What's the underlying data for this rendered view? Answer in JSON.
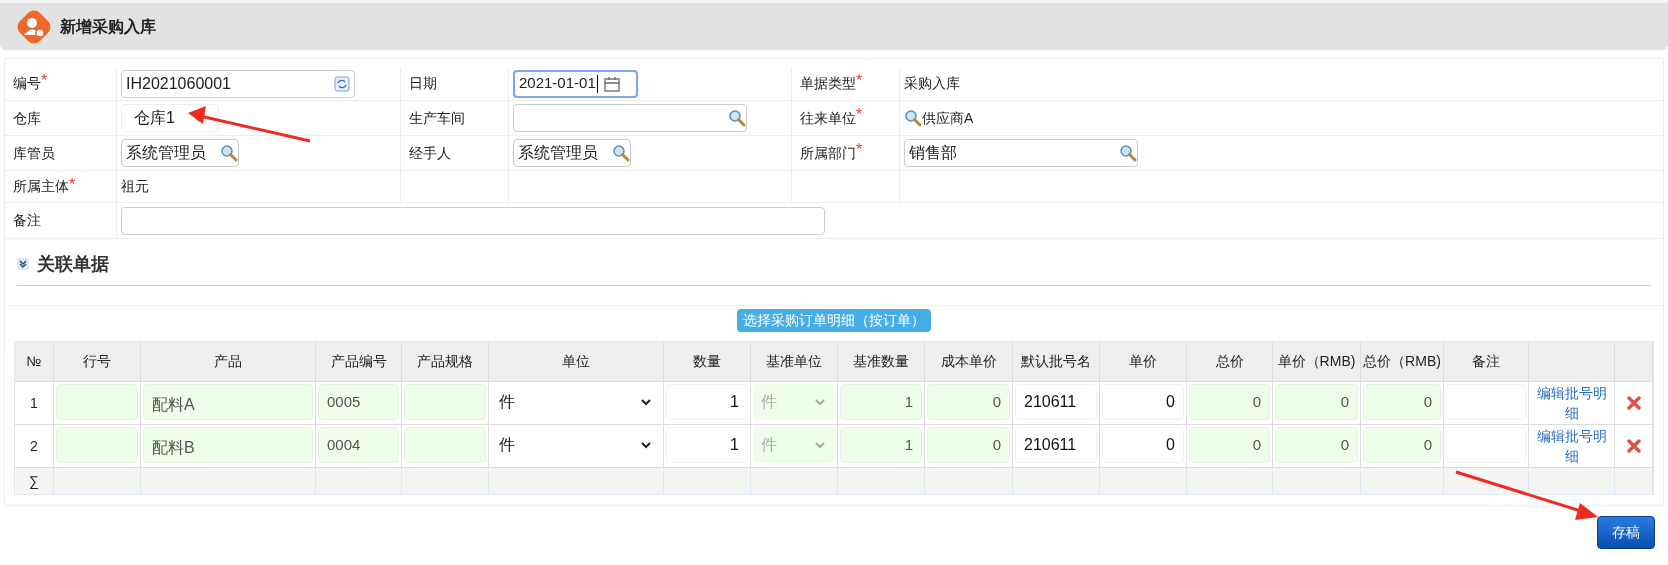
{
  "header": {
    "title": "新增采购入库"
  },
  "form": {
    "rows": [
      {
        "fields": [
          {
            "label": "编号",
            "required_mark": "*",
            "kind": "code",
            "value": "IH2021060001"
          },
          {
            "label": "日期",
            "kind": "date",
            "value": "2021-01-01",
            "focused": true
          },
          {
            "label": "单据类型",
            "required_mark": "*",
            "kind": "text",
            "value": "采购入库"
          }
        ]
      },
      {
        "fields": [
          {
            "label": "仓库",
            "kind": "select",
            "value": "仓库1"
          },
          {
            "label": "生产车间",
            "kind": "long-lookup"
          },
          {
            "label": "往来单位",
            "required_mark": "*",
            "kind": "lookup-text",
            "value": "供应商A"
          }
        ]
      },
      {
        "fields": [
          {
            "label": "库管员",
            "kind": "lookup",
            "value": "系统管理员"
          },
          {
            "label": "经手人",
            "kind": "lookup",
            "value": "系统管理员"
          },
          {
            "label": "所属部门",
            "required_mark": "*",
            "kind": "long-lookup",
            "value": "销售部"
          }
        ]
      },
      {
        "fields": [
          {
            "label": "所属主体",
            "required_mark": "*",
            "kind": "text",
            "value": "祖元"
          }
        ]
      },
      {
        "fields": [
          {
            "label": "备注",
            "kind": "memo"
          }
        ]
      }
    ]
  },
  "section": {
    "title": "关联单据",
    "expanded": true
  },
  "pick_button": "选择采购订单明细（按订单）",
  "table": {
    "columns": [
      "№",
      "行号",
      "产品",
      "产品编号",
      "产品规格",
      "单位",
      "数量",
      "基准单位",
      "基准数量",
      "成本单价",
      "默认批号名",
      "单价",
      "总价",
      "单价（RMB)",
      "总价（RMB)",
      "备注"
    ],
    "rows": [
      {
        "no": "1",
        "product": "配料A",
        "code": "0005",
        "unit": "件",
        "qty": "1",
        "base_unit": "件",
        "base_qty": "1",
        "cost": "0",
        "batch": "210611",
        "price": "0",
        "total": "0",
        "price_rmb": "0",
        "total_rmb": "0",
        "link": "编辑批号明细"
      },
      {
        "no": "2",
        "product": "配料B",
        "code": "0004",
        "unit": "件",
        "qty": "1",
        "base_unit": "件",
        "base_qty": "1",
        "cost": "0",
        "batch": "210611",
        "price": "0",
        "total": "0",
        "price_rmb": "0",
        "total_rmb": "0",
        "link": "编辑批号明细"
      }
    ],
    "summary_symbol": "∑"
  },
  "save_button": "存稿"
}
